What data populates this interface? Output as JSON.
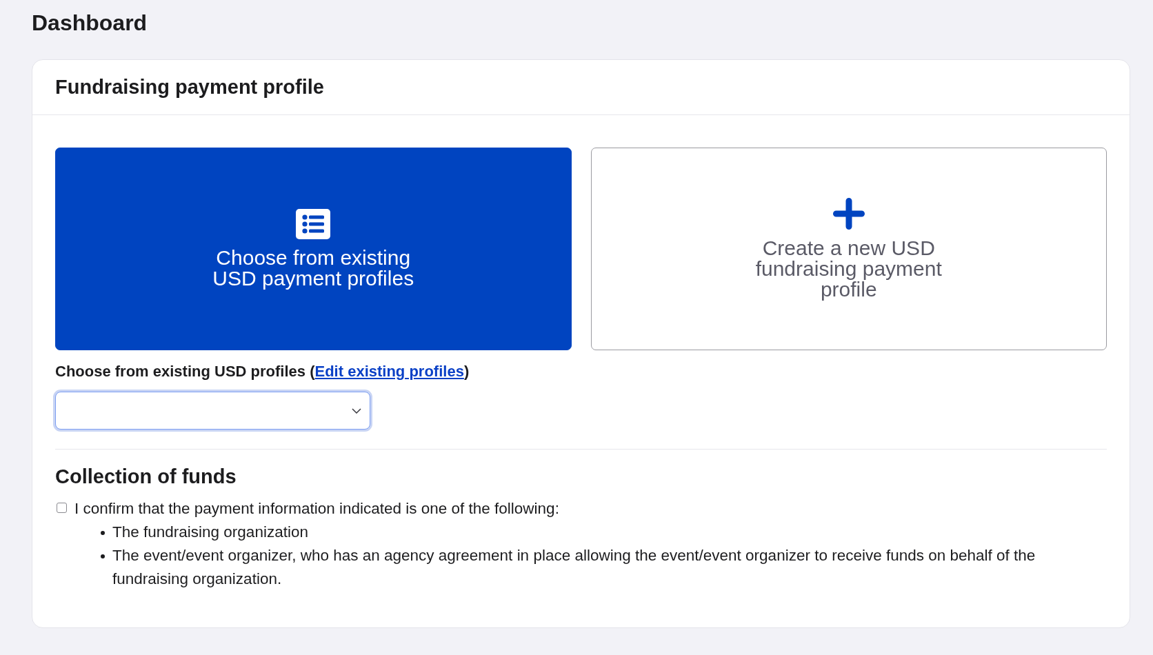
{
  "page": {
    "title": "Dashboard"
  },
  "panel": {
    "title": "Fundraising payment profile",
    "options": [
      {
        "kind": "list",
        "label": "Choose from existing USD payment profiles",
        "selected": true
      },
      {
        "kind": "create",
        "label": "Create a new USD fundraising payment profile",
        "selected": false
      }
    ],
    "profile_select": {
      "label": "Choose from existing USD profiles (",
      "link": "Edit existing profiles",
      "label_end": ")",
      "focused": true
    },
    "collection": {
      "title": "Collection of funds",
      "confirm": {
        "label": "I confirm that the payment information indicated is one of the following:",
        "checked": false
      },
      "bullets": [
        "The fundraising organization",
        "The event/event organizer, who has an agency agreement in place allowing the event/event organizer to receive funds on behalf of the fundraising organization."
      ]
    }
  }
}
